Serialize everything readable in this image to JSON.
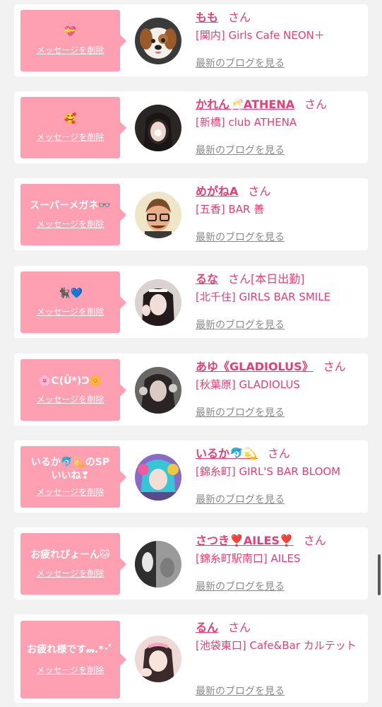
{
  "delete_label": "メッセージを削除",
  "blog_label": "最新のブログを見る",
  "san_label": "さん",
  "colors": {
    "accent": "#e83e73",
    "bubble": "#ff9fb2",
    "muted": "#8a8a8a",
    "background": "#f2f2f2"
  },
  "favorites": [
    {
      "message": "💝",
      "name": "もも",
      "extra": "",
      "shop": "[関内] Girls Cafe NEON＋",
      "avatar": "dog-emoji-avatar"
    },
    {
      "message": "🥰",
      "name": "かれん🥂ATHENA",
      "extra": "",
      "shop": "[新橋] club ATHENA",
      "avatar": "girl-photo-avatar"
    },
    {
      "message": "スーパーメガネ👓",
      "name": "めがねA",
      "extra": "",
      "shop": "[五香] BAR 善",
      "avatar": "glasses-illustration-avatar"
    },
    {
      "message": "🐈‍⬛💙",
      "name": "るな",
      "extra": "[本日出勤]",
      "shop": "[北千住] GIRLS BAR SMILE",
      "avatar": "girl-photo-avatar"
    },
    {
      "message": "🌸ᕦ(Ü*)ᕤ🌼",
      "name": "あゆ《GLADIOLUS》",
      "extra": "",
      "shop": "[秋葉原] GLADIOLUS",
      "avatar": "girl-photo-avatar"
    },
    {
      "message": "いるか🐬💫のSP\nいいね❣",
      "name": "いるか🐬💫",
      "extra": "",
      "shop": "[錦糸町] GIRL'S BAR BLOOM",
      "avatar": "colorful-hair-photo-avatar"
    },
    {
      "message": "お疲れぴょーん🐱",
      "name": "さつき❣️AILES❣️",
      "extra": "",
      "shop": "[錦糸町駅南口] AILES",
      "avatar": "monochrome-photo-avatar"
    },
    {
      "message": "お疲れ様です𝓂.*･ﾟ",
      "name": "るん",
      "extra": "",
      "shop": "[池袋東口] Cafe&Bar カルテット",
      "avatar": "girl-photo-avatar"
    }
  ]
}
